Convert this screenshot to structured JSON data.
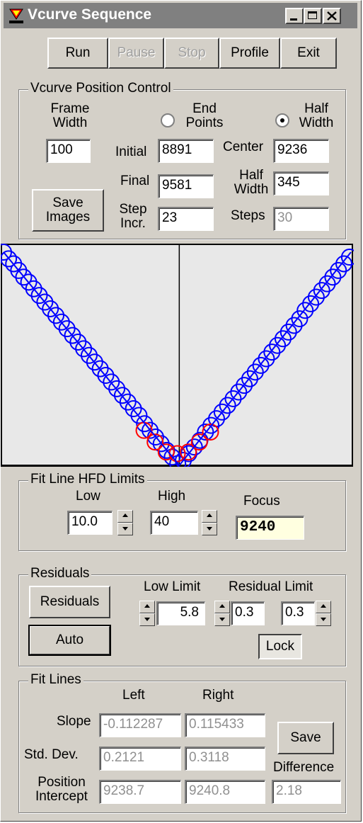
{
  "window": {
    "title": "Vcurve Sequence"
  },
  "toolbar": {
    "run": "Run",
    "pause": "Pause",
    "stop": "Stop",
    "profile": "Profile",
    "exit": "Exit"
  },
  "position_control": {
    "title": "Vcurve Position Control",
    "frame_width_label": "Frame Width",
    "frame_width": "100",
    "end_points_label": "End Points",
    "half_width_mode_label": "Half Width",
    "selected_mode": "Half Width",
    "initial_label": "Initial",
    "initial": "8891",
    "final_label": "Final",
    "final": "9581",
    "step_incr_label": "Step Incr.",
    "step_incr": "23",
    "center_label": "Center",
    "center": "9236",
    "half_width_label": "Half Width",
    "half_width": "345",
    "steps_label": "Steps",
    "steps": "30",
    "save_images": "Save Images"
  },
  "chart_data": {
    "type": "scatter",
    "title": "",
    "xlabel": "",
    "ylabel": "",
    "grid": false,
    "x_range": [
      8891,
      9581
    ],
    "y_range": [
      0,
      12.8
    ],
    "focus_marker_x": 9240,
    "colors": {
      "fit": "#0000ff",
      "residual": "#ff0000",
      "background": "#e8e8e8"
    },
    "series": [
      {
        "role": "fit-line-left",
        "points": [
          [
            8891,
            12.8
          ],
          [
            9240,
            0
          ]
        ]
      },
      {
        "role": "fit-line-right",
        "points": [
          [
            9240,
            0
          ],
          [
            9581,
            12.8
          ]
        ]
      },
      {
        "role": "samples",
        "color": "#0000ff",
        "x": [
          8891,
          8901,
          8911,
          8921,
          8931,
          8941,
          8951,
          8962,
          8973,
          8984,
          8995,
          9006,
          9017,
          9028,
          9039,
          9050,
          9061,
          9072,
          9083,
          9094,
          9105,
          9116,
          9127,
          9138,
          9149,
          9160,
          9171,
          9182,
          9193,
          9204,
          9215,
          9226,
          9237,
          9248,
          9259,
          9270,
          9281,
          9292,
          9303,
          9314,
          9325,
          9336,
          9347,
          9358,
          9369,
          9380,
          9391,
          9402,
          9413,
          9424,
          9435,
          9446,
          9457,
          9468,
          9479,
          9490,
          9501,
          9512,
          9523,
          9534,
          9545,
          9556,
          9567,
          9578
        ],
        "y": [
          12.8,
          12.4,
          12.1,
          11.7,
          11.3,
          11.0,
          10.6,
          10.2,
          9.8,
          9.4,
          9.0,
          8.6,
          8.2,
          7.8,
          7.4,
          7.0,
          6.6,
          6.2,
          5.8,
          5.4,
          5.0,
          4.6,
          4.2,
          3.8,
          3.4,
          3.0,
          2.5,
          2.1,
          1.7,
          1.3,
          0.9,
          0.5,
          0.1,
          0.3,
          0.7,
          1.1,
          1.5,
          2.0,
          2.4,
          2.8,
          3.2,
          3.6,
          4.0,
          4.4,
          4.8,
          5.2,
          5.6,
          6.0,
          6.4,
          6.8,
          7.2,
          7.6,
          8.0,
          8.4,
          8.8,
          9.3,
          9.7,
          10.1,
          10.5,
          10.9,
          11.3,
          11.7,
          12.1,
          12.5
        ]
      },
      {
        "role": "residuals",
        "color": "#ff0000",
        "x": [
          9170,
          9192,
          9214,
          9236,
          9258,
          9280,
          9302
        ],
        "y": [
          2.1,
          1.4,
          0.8,
          0.7,
          0.8,
          1.4,
          2.0
        ]
      }
    ]
  },
  "fit_limits": {
    "title": "Fit Line HFD Limits",
    "low_label": "Low",
    "low": "10.0",
    "high_label": "High",
    "high": "40",
    "focus_label": "Focus",
    "focus": "9240"
  },
  "residuals": {
    "title": "Residuals",
    "residuals_button": "Residuals",
    "auto_button": "Auto",
    "low_limit_label": "Low Limit",
    "low_limit": "5.8",
    "residual_limit_label": "Residual Limit",
    "residual_limit_left": "0.3",
    "residual_limit_right": "0.3",
    "lock_button": "Lock"
  },
  "fit_lines": {
    "title": "Fit Lines",
    "left_label": "Left",
    "right_label": "Right",
    "slope_label": "Slope",
    "slope_left": "-0.112287",
    "slope_right": "0.115433",
    "std_dev_label": "Std. Dev.",
    "std_dev_left": "0.2121",
    "std_dev_right": "0.3118",
    "pos_intercept_label": "Position Intercept",
    "intercept_left": "9238.7",
    "intercept_right": "9240.8",
    "difference_label": "Difference",
    "difference": "2.18",
    "save_button": "Save"
  }
}
